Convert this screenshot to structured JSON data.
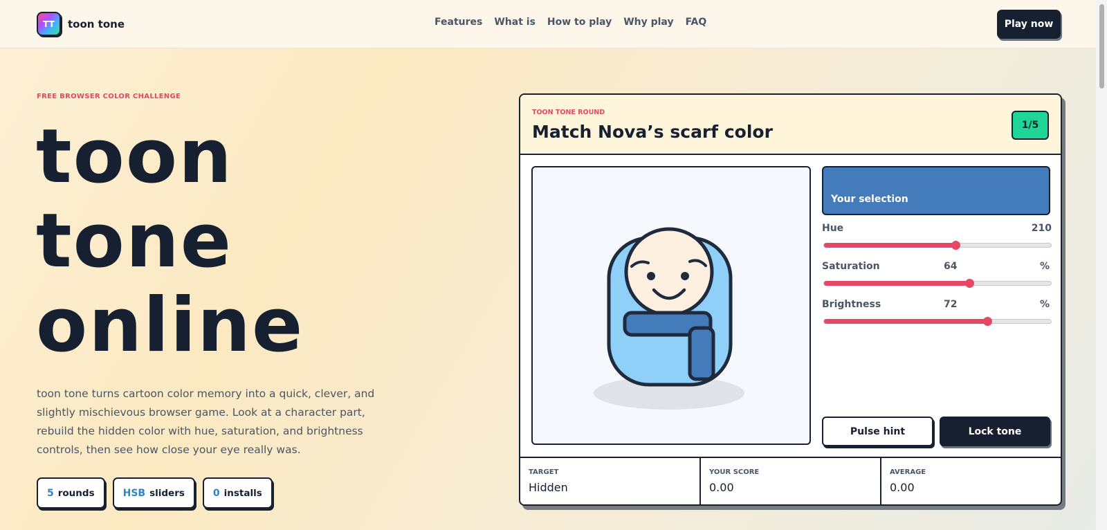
{
  "brand": {
    "logo_text": "TT",
    "name": "toon tone"
  },
  "nav": [
    "Features",
    "What is",
    "How to play",
    "Why play",
    "FAQ"
  ],
  "header": {
    "cta_label": "Play now"
  },
  "hero": {
    "eyebrow": "FREE BROWSER COLOR CHALLENGE",
    "title_lines": [
      "toon",
      "tone",
      "online"
    ],
    "description": "toon tone turns cartoon color memory into a quick, clever, and slightly mischievous browser game. Look at a character part, rebuild the hidden color with hue, saturation, and brightness controls, then see how close your eye really was.",
    "chips": [
      {
        "value": "5",
        "label": "rounds"
      },
      {
        "value": "HSB",
        "label": "sliders"
      },
      {
        "value": "0",
        "label": "installs"
      }
    ]
  },
  "game": {
    "round_label": "TOON TONE ROUND",
    "round_title": "Match Nova’s scarf color",
    "round_badge": "1/5",
    "selection_label": "Your selection",
    "selection_color": "#437bbb",
    "sliders": {
      "hue": {
        "label": "Hue",
        "value": "210",
        "unit": "",
        "fraction": 0.58
      },
      "saturation": {
        "label": "Saturation",
        "value": "64",
        "unit": "%",
        "fraction": 0.64
      },
      "brightness": {
        "label": "Brightness",
        "value": "72",
        "unit": "%",
        "fraction": 0.72
      }
    },
    "hint_label": "Pulse hint",
    "lock_label": "Lock tone",
    "stats": [
      {
        "label": "TARGET",
        "value": "Hidden"
      },
      {
        "label": "YOUR SCORE",
        "value": "0.00"
      },
      {
        "label": "AVERAGE",
        "value": "0.00"
      }
    ]
  },
  "colors": {
    "accent": "#e44864",
    "dark": "#172030",
    "badge": "#1fd696",
    "character_body": "#8fd0f8",
    "scarf": "#437bbb"
  }
}
